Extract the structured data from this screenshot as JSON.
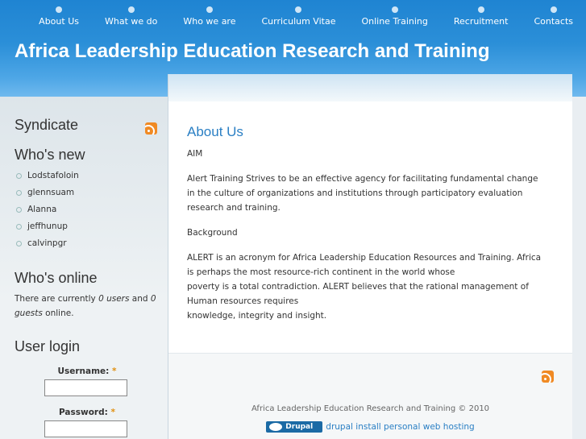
{
  "header": {
    "nav": [
      "About Us",
      "What we do",
      "Who we are",
      "Curriculum Vitae",
      "Online Training",
      "Recruitment",
      "Contacts"
    ],
    "site_title": "Africa Leadership Education Research and Training"
  },
  "sidebar": {
    "syndicate_title": "Syndicate",
    "whos_new_title": "Who's new",
    "users": [
      "Lodstafoloin",
      "glennsuam",
      "Alanna",
      "jeffhunup",
      "calvinpgr"
    ],
    "whos_online_title": "Who's online",
    "online_prefix": "There are currently ",
    "online_users": "0 users",
    "online_and": " and ",
    "online_guests": "0 guests",
    "online_suffix": " online.",
    "login_title": "User login",
    "username_label": "Username:",
    "password_label": "Password:",
    "required_mark": "*"
  },
  "main": {
    "title": "About Us",
    "aim": "AIM",
    "p1_line1": "Alert Training Strives to be an effective agency for facilitating fundamental change",
    "p1_line2": "in the culture of organizations and institutions through participatory evaluation research and training.",
    "background": "Background",
    "p2_line1": "ALERT is an acronym for Africa Leadership Education Resources and Training. Africa",
    "p2_line2": "is perhaps the most resource-rich continent in the world whose",
    "p2_line3": "poverty is a total contradiction. ALERT believes that the rational management of Human resources requires",
    "p2_line4": "knowledge, integrity and insight.",
    "copyright": "Africa Leadership Education Research and Training © 2010",
    "drupal_badge": "Drupal",
    "powered_link": "drupal install personal web hosting"
  },
  "colors": {
    "header_blue": "#1f84d2",
    "title_blue": "#2a7fc4",
    "rss_orange": "#f08a24"
  },
  "icons": [
    "rss-icon",
    "bullet-icon",
    "drupal-logo-icon"
  ]
}
